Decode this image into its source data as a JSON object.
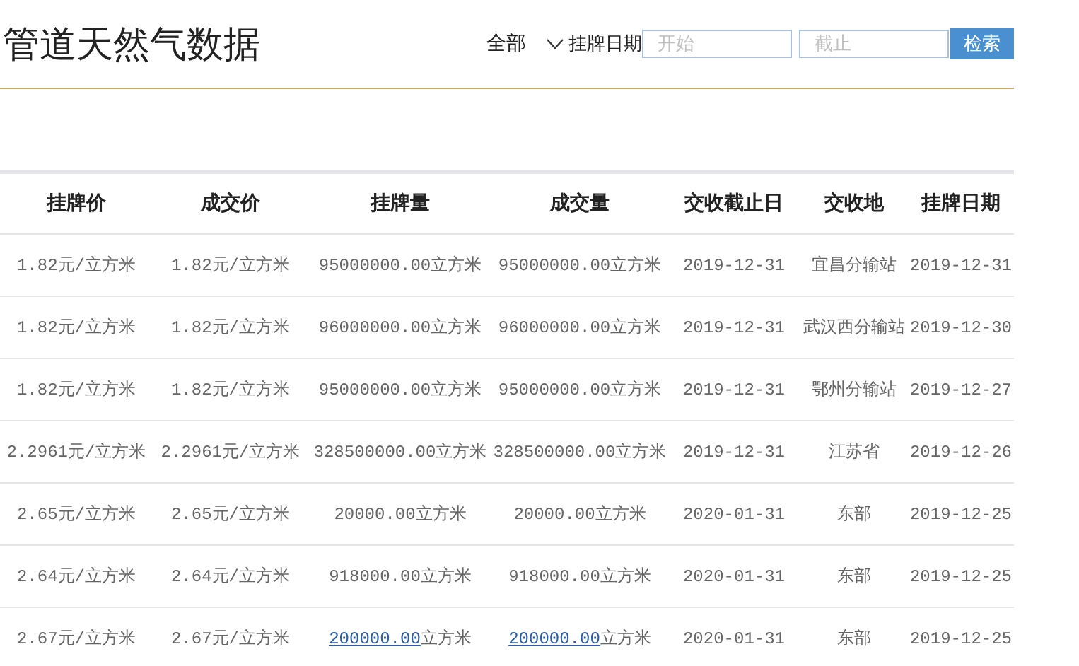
{
  "title": "管道天然气数据",
  "filter": {
    "scope": "全部",
    "date_label": "挂牌日期",
    "start": {
      "placeholder": "开始"
    },
    "end": {
      "placeholder": "截止"
    },
    "search_button": "检索"
  },
  "table": {
    "columns": [
      "挂牌价",
      "成交价",
      "挂牌量",
      "成交量",
      "交收截止日",
      "交收地",
      "挂牌日期"
    ],
    "rows": [
      [
        "1.82元/立方米",
        "1.82元/立方米",
        "95000000.00立方米",
        "95000000.00立方米",
        "2019-12-31",
        "宜昌分输站",
        "2019-12-31"
      ],
      [
        "1.82元/立方米",
        "1.82元/立方米",
        "96000000.00立方米",
        "96000000.00立方米",
        "2019-12-31",
        "武汉西分输站",
        "2019-12-30"
      ],
      [
        "1.82元/立方米",
        "1.82元/立方米",
        "95000000.00立方米",
        "95000000.00立方米",
        "2019-12-31",
        "鄂州分输站",
        "2019-12-27"
      ],
      [
        "2.2961元/立方米",
        "2.2961元/立方米",
        "328500000.00立方米",
        "328500000.00立方米",
        "2019-12-31",
        "江苏省",
        "2019-12-26"
      ],
      [
        "2.65元/立方米",
        "2.65元/立方米",
        "20000.00立方米",
        "20000.00立方米",
        "2020-01-31",
        "东部",
        "2019-12-25"
      ],
      [
        "2.64元/立方米",
        "2.64元/立方米",
        "918000.00立方米",
        "918000.00立方米",
        "2020-01-31",
        "东部",
        "2019-12-25"
      ],
      [
        "2.67元/立方米",
        "2.67元/立方米",
        {
          "link": "200000.00",
          "suffix": "立方米"
        },
        {
          "link": "200000.00",
          "suffix": "立方米"
        },
        "2020-01-31",
        "东部",
        "2019-12-25"
      ]
    ]
  }
}
